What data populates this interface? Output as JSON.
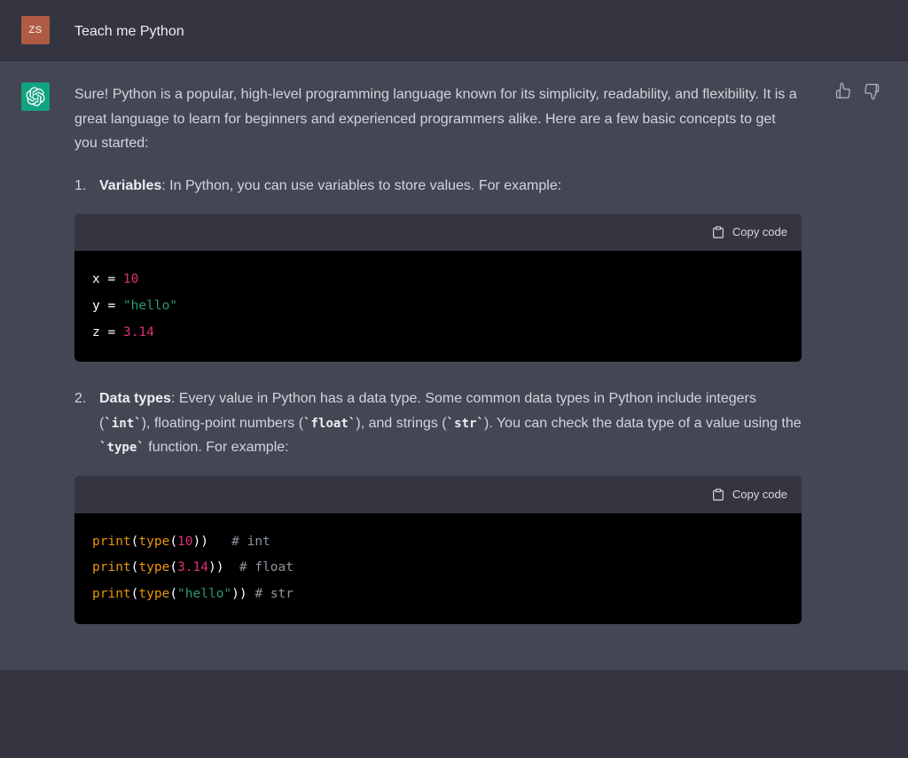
{
  "user": {
    "avatar_initials": "ZS",
    "message": "Teach me Python"
  },
  "assistant": {
    "intro": "Sure! Python is a popular, high-level programming language known for its simplicity, readability, and flexibility. It is a great language to learn for beginners and experienced programmers alike. Here are a few basic concepts to get you started:",
    "items": [
      {
        "title": "Variables",
        "desc": ": In Python, you can use variables to store values. For example:"
      },
      {
        "title": "Data types",
        "desc_pre": ": Every value in Python has a data type. Some common data types in Python include integers (",
        "code1": "`int`",
        "mid1": "), floating-point numbers (",
        "code2": "`float`",
        "mid2": "), and strings (",
        "code3": "`str`",
        "mid3": "). You can check the data type of a value using the ",
        "code4": "`type`",
        "desc_post": " function. For example:"
      }
    ],
    "copy_label": "Copy code",
    "code1": {
      "l1a": "x = ",
      "l1b": "10",
      "l2a": "y = ",
      "l2b": "\"hello\"",
      "l3a": "z = ",
      "l3b": "3.14"
    },
    "code2": {
      "l1a": "print",
      "l1b": "(",
      "l1c": "type",
      "l1d": "(",
      "l1e": "10",
      "l1f": "))   ",
      "l1g": "# int",
      "l2a": "print",
      "l2b": "(",
      "l2c": "type",
      "l2d": "(",
      "l2e": "3.14",
      "l2f": "))  ",
      "l2g": "# float",
      "l3a": "print",
      "l3b": "(",
      "l3c": "type",
      "l3d": "(",
      "l3e": "\"hello\"",
      "l3f": ")) ",
      "l3g": "# str"
    }
  }
}
